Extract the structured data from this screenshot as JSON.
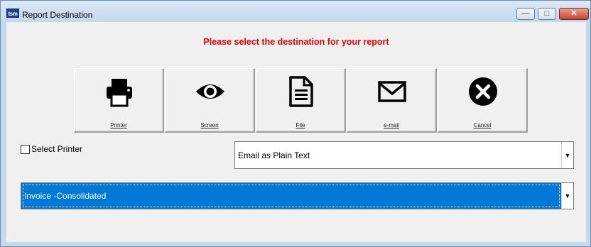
{
  "window": {
    "title": "Report Destination",
    "app_icon_text": "tsm"
  },
  "controls": {
    "minimize": "—",
    "maximize": "□",
    "close": "✕"
  },
  "prompt": "Please select the destination for your report",
  "buttons": [
    {
      "label": "Printer",
      "icon": "printer-icon"
    },
    {
      "label": "Screen",
      "icon": "eye-icon"
    },
    {
      "label": "File",
      "icon": "file-icon"
    },
    {
      "label": "e-mail",
      "icon": "envelope-icon"
    },
    {
      "label": "Cancel",
      "icon": "cancel-icon"
    }
  ],
  "select_printer": {
    "label": "Select Printer",
    "checked": false
  },
  "email_format": {
    "value": "Email as Plain Text"
  },
  "report": {
    "value": "Invoice -Consolidated"
  },
  "colors": {
    "prompt": "#e60000",
    "selection": "#0078d7"
  }
}
